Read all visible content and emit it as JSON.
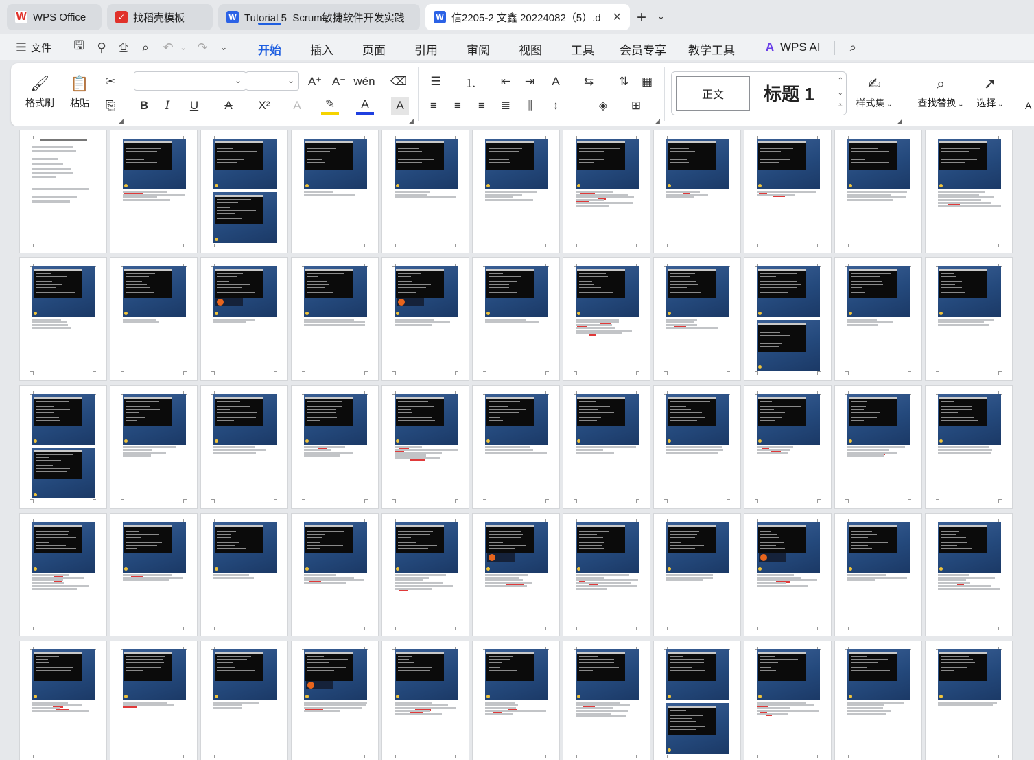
{
  "tabs": [
    {
      "label": "WPS Office",
      "icon": "wps-logo-icon",
      "color": "#e0312a"
    },
    {
      "label": "找稻壳模板",
      "icon": "docer-icon",
      "color": "#e0312a"
    },
    {
      "label": "Tutorial 5_Scrum敏捷软件开发实践",
      "icon": "writer-doc-icon",
      "color": "#2b62e6"
    },
    {
      "label": "信2205-2 文鑫 20224082（5）.d",
      "icon": "writer-doc-icon",
      "color": "#2b62e6"
    }
  ],
  "new_tab": "+",
  "menu": {
    "file": "文件",
    "items": [
      "开始",
      "插入",
      "页面",
      "引用",
      "审阅",
      "视图",
      "工具",
      "会员专享",
      "教学工具",
      "WPS AI"
    ],
    "active": "开始"
  },
  "ribbon": {
    "format_painter": "格式刷",
    "paste": "粘贴",
    "styles_normal": "正文",
    "styles_heading": "标题 1",
    "style_set": "样式集",
    "find_replace": "查找替换",
    "select": "选择",
    "cutoff_label": "A",
    "font_name": "",
    "font_size": ""
  },
  "colors": {
    "accent": "#1f5fe0",
    "highlight": "#f5d300",
    "font_color": "#1f3fe0"
  },
  "document": {
    "rows": 5,
    "columns": 11
  }
}
